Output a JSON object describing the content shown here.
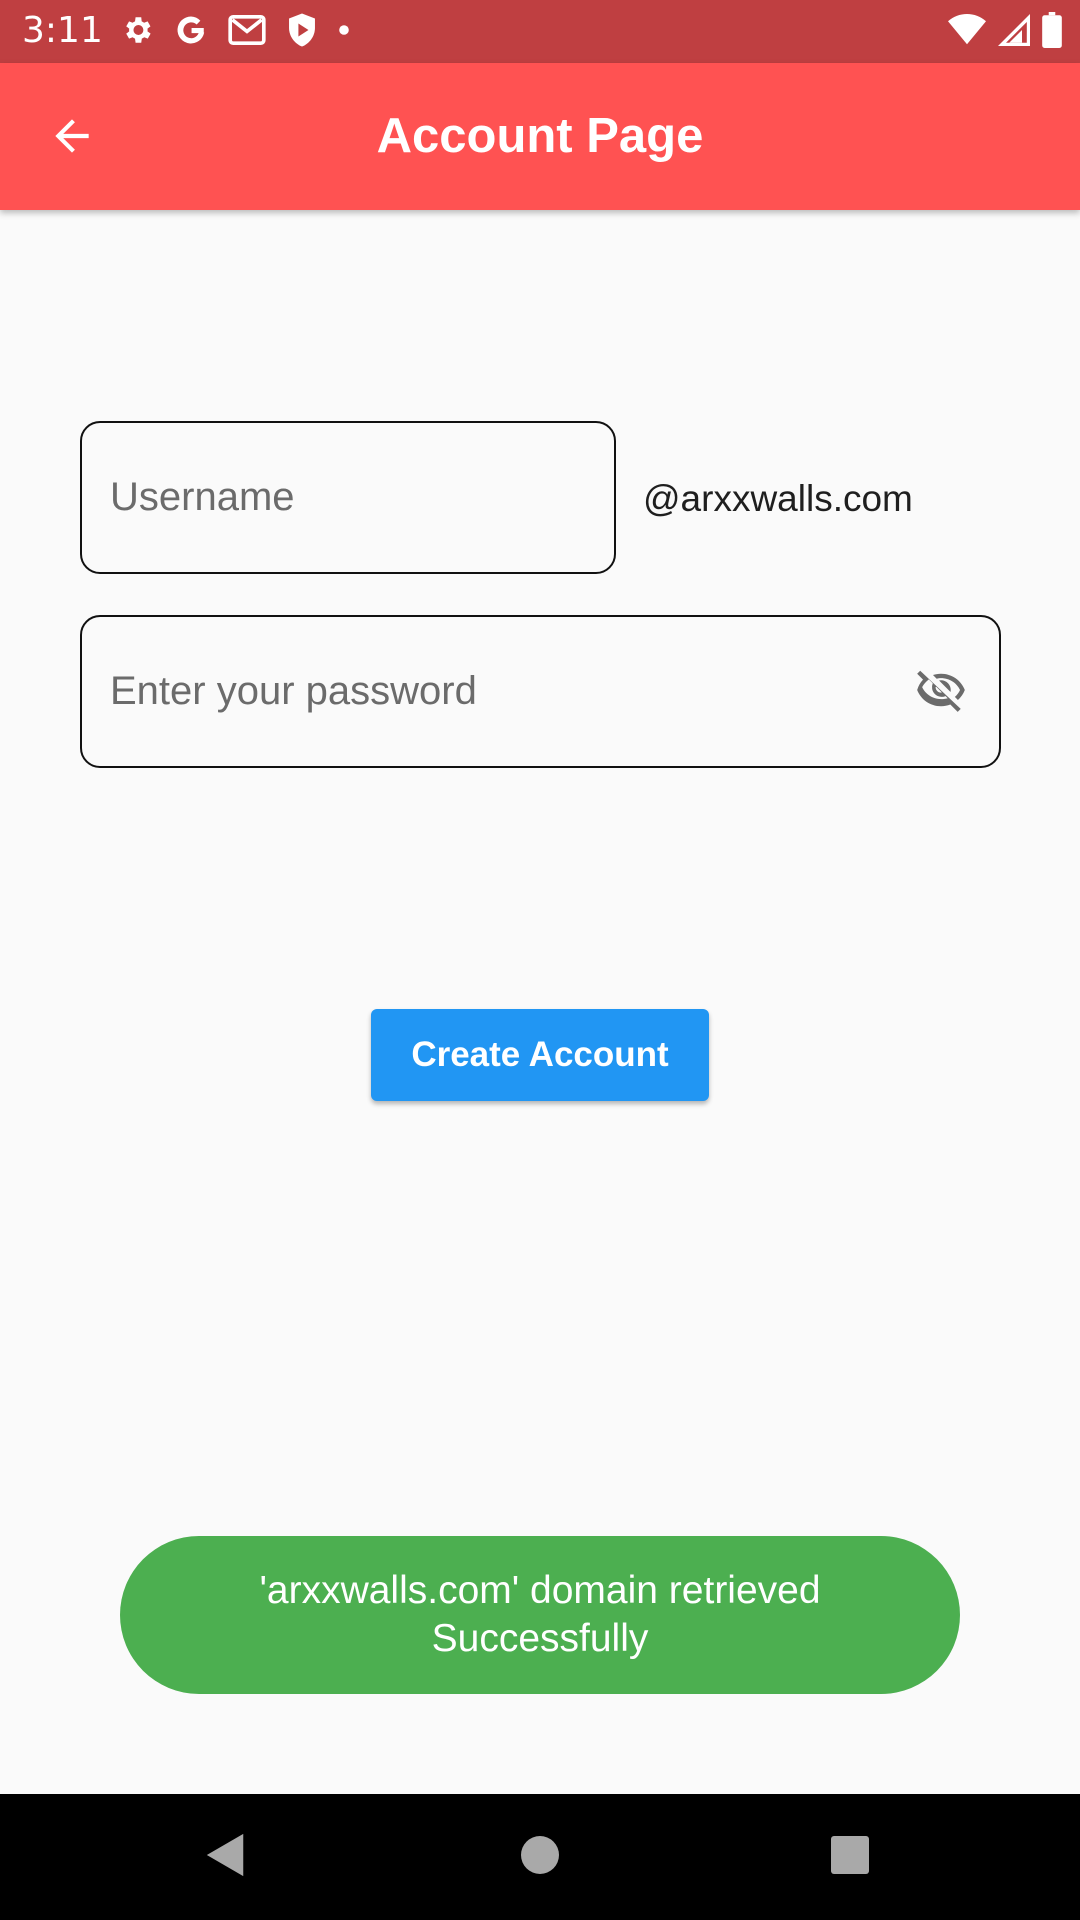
{
  "status_bar": {
    "time": "3:11",
    "icons_left": [
      "settings-icon",
      "google-icon",
      "gmail-icon",
      "shield-play-icon",
      "dot-icon"
    ],
    "icons_right": [
      "wifi-icon",
      "signal-icon",
      "battery-icon"
    ]
  },
  "app_bar": {
    "title": "Account Page",
    "back_icon": "arrow-back-icon"
  },
  "form": {
    "username_placeholder": "Username",
    "username_value": "",
    "domain_suffix": "@arxxwalls.com",
    "password_placeholder": "Enter your password",
    "password_value": "",
    "visibility_icon": "visibility-off-icon",
    "create_button_label": "Create Account"
  },
  "toast": {
    "line1": "'arxxwalls.com' domain retrieved",
    "line2": "Successfully"
  },
  "nav_bar": {
    "icons": [
      "back-triangle-icon",
      "home-circle-icon",
      "recents-square-icon"
    ]
  },
  "colors": {
    "status_bar": "#bf3f41",
    "app_bar": "#ff5252",
    "button": "#2196f3",
    "toast": "#4caf50",
    "background": "#fafafa"
  }
}
